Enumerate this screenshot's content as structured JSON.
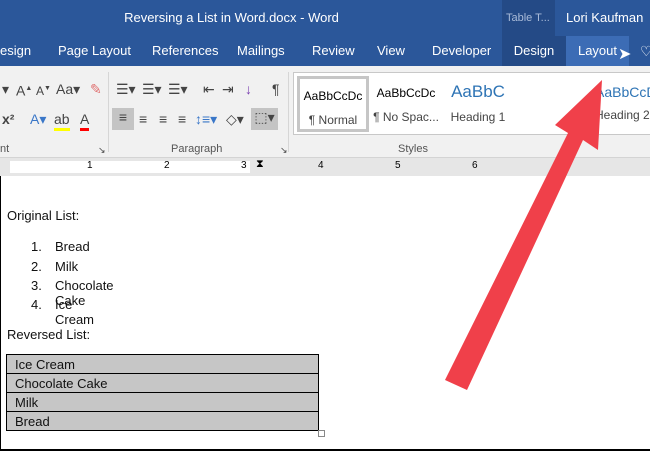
{
  "titlebar": {
    "title": "Reversing a List in Word.docx - Word",
    "context_group": "Table T...",
    "user": "Lori Kaufman"
  },
  "tabs": [
    {
      "label": "esign"
    },
    {
      "label": "Page Layout"
    },
    {
      "label": "References"
    },
    {
      "label": "Mailings"
    },
    {
      "label": "Review"
    },
    {
      "label": "View"
    },
    {
      "label": "Developer"
    },
    {
      "label": "Design"
    },
    {
      "label": "Layout",
      "active": true
    }
  ],
  "ribbon": {
    "groups": [
      {
        "label": "nt"
      },
      {
        "label": "Paragraph"
      },
      {
        "label": "Styles"
      }
    ],
    "styles": [
      {
        "preview": "AaBbCcDc",
        "name": "¶ Normal"
      },
      {
        "preview": "AaBbCcDc",
        "name": "¶ No Spac..."
      },
      {
        "preview": "AaBbC",
        "name": "Heading 1"
      },
      {
        "preview": "AaBbCcD",
        "name": "Heading 2"
      }
    ]
  },
  "ruler": {
    "marks": [
      "1",
      "2",
      "3",
      "4",
      "5",
      "6"
    ]
  },
  "document": {
    "original_heading": "Original List:",
    "original_list": [
      {
        "num": "1.",
        "text": "Bread"
      },
      {
        "num": "2.",
        "text": "Milk"
      },
      {
        "num": "3.",
        "text": "Chocolate Cake"
      },
      {
        "num": "4.",
        "text": "Ice Cream"
      }
    ],
    "reversed_heading": "Reversed List:",
    "reversed_table": [
      "Ice Cream",
      "Chocolate Cake",
      "Milk",
      "Bread"
    ]
  },
  "colors": {
    "accent": "#2b579a",
    "arrow": "#f0404a",
    "selection": "#c6c6c6"
  }
}
